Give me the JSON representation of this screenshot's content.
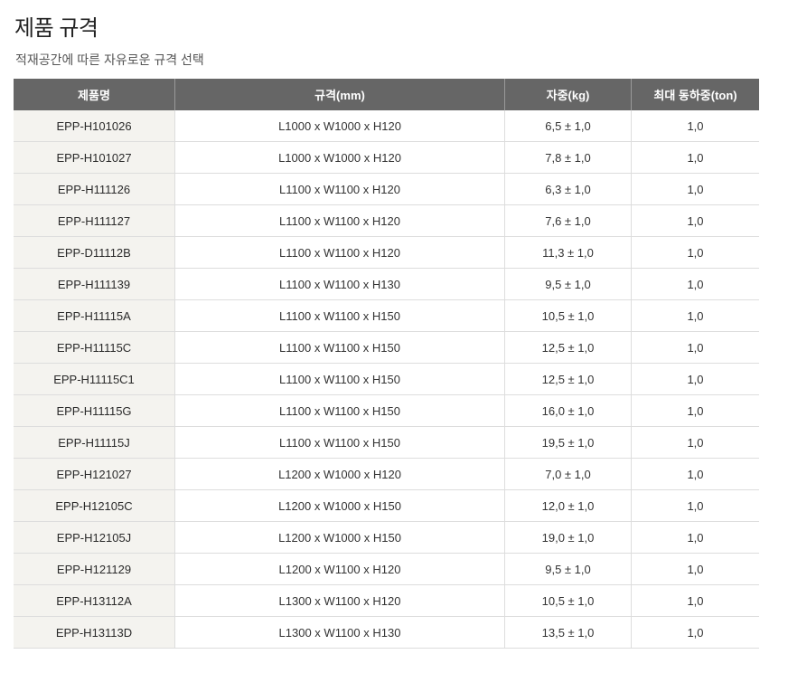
{
  "page": {
    "title": "제품 규격",
    "subtitle": "적재공간에 따른 자유로운 규격 선택"
  },
  "table": {
    "headers": [
      "제품명",
      "규격(mm)",
      "자중(kg)",
      "최대 동하중(ton)"
    ],
    "rows": [
      {
        "model": "EPP-H101026",
        "size": "L1000 x W1000 x H120",
        "weight": "6,5 ± 1,0",
        "load": "1,0"
      },
      {
        "model": "EPP-H101027",
        "size": "L1000 x W1000 x H120",
        "weight": "7,8 ± 1,0",
        "load": "1,0"
      },
      {
        "model": "EPP-H111126",
        "size": "L1100 x W1100 x H120",
        "weight": "6,3 ± 1,0",
        "load": "1,0"
      },
      {
        "model": "EPP-H111127",
        "size": "L1100 x W1100 x H120",
        "weight": "7,6 ± 1,0",
        "load": "1,0"
      },
      {
        "model": "EPP-D11112B",
        "size": "L1100 x W1100 x H120",
        "weight": "11,3 ± 1,0",
        "load": "1,0"
      },
      {
        "model": "EPP-H111139",
        "size": "L1100 x W1100 x H130",
        "weight": "9,5 ± 1,0",
        "load": "1,0"
      },
      {
        "model": "EPP-H11115A",
        "size": "L1100 x W1100 x H150",
        "weight": "10,5 ± 1,0",
        "load": "1,0"
      },
      {
        "model": "EPP-H11115C",
        "size": "L1100 x W1100 x H150",
        "weight": "12,5 ± 1,0",
        "load": "1,0"
      },
      {
        "model": "EPP-H11115C1",
        "size": "L1100 x W1100 x H150",
        "weight": "12,5 ± 1,0",
        "load": "1,0"
      },
      {
        "model": "EPP-H11115G",
        "size": "L1100 x W1100 x H150",
        "weight": "16,0 ± 1,0",
        "load": "1,0"
      },
      {
        "model": "EPP-H11115J",
        "size": "L1100 x W1100 x H150",
        "weight": "19,5 ± 1,0",
        "load": "1,0"
      },
      {
        "model": "EPP-H121027",
        "size": "L1200 x W1000 x H120",
        "weight": "7,0 ± 1,0",
        "load": "1,0"
      },
      {
        "model": "EPP-H12105C",
        "size": "L1200 x W1000 x H150",
        "weight": "12,0 ± 1,0",
        "load": "1,0"
      },
      {
        "model": "EPP-H12105J",
        "size": "L1200 x W1000 x H150",
        "weight": "19,0 ± 1,0",
        "load": "1,0"
      },
      {
        "model": "EPP-H121129",
        "size": "L1200 x W1100 x H120",
        "weight": "9,5 ± 1,0",
        "load": "1,0"
      },
      {
        "model": "EPP-H13112A",
        "size": "L1300 x W1100 x H120",
        "weight": "10,5 ± 1,0",
        "load": "1,0"
      },
      {
        "model": "EPP-H13113D",
        "size": "L1300 x W1100 x H130",
        "weight": "13,5 ± 1,0",
        "load": "1,0"
      }
    ]
  },
  "colors": {
    "header_bg": "#666666",
    "header_text": "#ffffff",
    "header_divider": "#999999",
    "first_col_bg": "#f4f3ef",
    "border": "#dddddd",
    "text": "#333333"
  }
}
